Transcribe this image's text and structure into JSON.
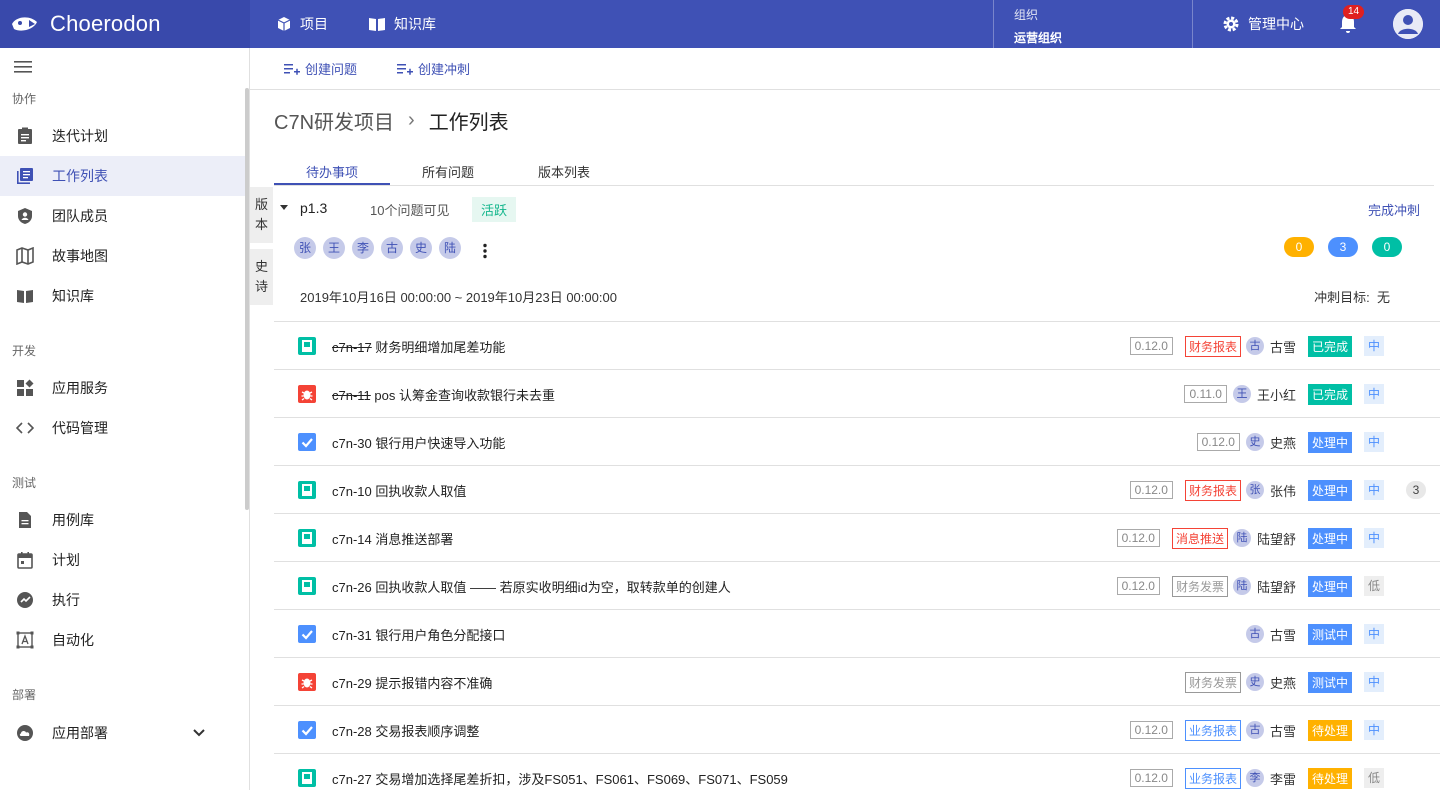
{
  "brand": {
    "name": "Choerodon"
  },
  "topnav": [
    {
      "label": "项目",
      "icon": "cube-icon"
    },
    {
      "label": "知识库",
      "icon": "book-icon"
    }
  ],
  "org": {
    "label": "组织",
    "value": "运营组织"
  },
  "admin": {
    "label": "管理中心"
  },
  "notifications": {
    "count": "14"
  },
  "sidebar": {
    "groups": [
      {
        "label": "协作",
        "items": [
          {
            "label": "迭代计划",
            "icon": "clipboard-icon"
          },
          {
            "label": "工作列表",
            "icon": "library-icon",
            "active": true
          },
          {
            "label": "团队成员",
            "icon": "shield-user-icon"
          },
          {
            "label": "故事地图",
            "icon": "map-icon"
          },
          {
            "label": "知识库",
            "icon": "book-icon"
          }
        ]
      },
      {
        "label": "开发",
        "items": [
          {
            "label": "应用服务",
            "icon": "widgets-icon"
          },
          {
            "label": "代码管理",
            "icon": "code-icon"
          }
        ]
      },
      {
        "label": "测试",
        "items": [
          {
            "label": "用例库",
            "icon": "document-icon"
          },
          {
            "label": "计划",
            "icon": "calendar-icon"
          },
          {
            "label": "执行",
            "icon": "speed-icon"
          },
          {
            "label": "自动化",
            "icon": "automation-icon"
          }
        ]
      },
      {
        "label": "部署",
        "items": [
          {
            "label": "应用部署",
            "icon": "cloud-icon"
          }
        ]
      }
    ]
  },
  "toolbar": {
    "create_issue": "创建问题",
    "create_sprint": "创建冲刺"
  },
  "breadcrumb": {
    "project": "C7N研发项目",
    "sep": "›",
    "page": "工作列表"
  },
  "tabs": [
    "待办事项",
    "所有问题",
    "版本列表"
  ],
  "side_tabs": {
    "version": "版本",
    "epic": "史诗"
  },
  "sprint": {
    "name": "p1.3",
    "count_text": "10个问题可见",
    "status": "活跃",
    "complete": "完成冲刺",
    "members": [
      "张",
      "王",
      "李",
      "古",
      "史",
      "陆"
    ],
    "counts": [
      {
        "value": "0",
        "color": "#ffb100"
      },
      {
        "value": "3",
        "color": "#4d90fe"
      },
      {
        "value": "0",
        "color": "#00bfa5"
      }
    ],
    "dates": "2019年10月16日 00:00:00 ~ 2019年10月23日 00:00:00",
    "goal_label": "冲刺目标:",
    "goal_value": "无"
  },
  "colors": {
    "primary": "#3f51b5",
    "story": "#00bfa5",
    "bug": "#f44336",
    "task": "#4d90fe",
    "done": "#00bfa5",
    "doing": "#4d90fe",
    "todo": "#ffb100"
  },
  "issues": [
    {
      "type": "story",
      "key": "c7n-17",
      "done": true,
      "summary": "财务明细增加尾差功能",
      "version": "0.12.0",
      "component": "财务报表",
      "comp_style": "red",
      "assignee_initial": "古",
      "assignee": "古雪",
      "status": "已完成",
      "status_kind": "done",
      "priority": "中",
      "prio_kind": "mid"
    },
    {
      "type": "bug",
      "key": "c7n-11",
      "done": true,
      "summary": "pos 认筹金查询收款银行未去重",
      "version": "0.11.0",
      "component": "",
      "comp_style": "",
      "assignee_initial": "王",
      "assignee": "王小红",
      "status": "已完成",
      "status_kind": "done",
      "priority": "中",
      "prio_kind": "mid"
    },
    {
      "type": "task",
      "key": "c7n-30",
      "done": false,
      "summary": "银行用户快速导入功能",
      "version": "0.12.0",
      "component": "",
      "comp_style": "",
      "assignee_initial": "史",
      "assignee": "史燕",
      "status": "处理中",
      "status_kind": "doing",
      "priority": "中",
      "prio_kind": "mid"
    },
    {
      "type": "story",
      "key": "c7n-10",
      "done": false,
      "summary": "回执收款人取值",
      "version": "0.12.0",
      "component": "财务报表",
      "comp_style": "red",
      "assignee_initial": "张",
      "assignee": "张伟",
      "status": "处理中",
      "status_kind": "doing",
      "priority": "中",
      "prio_kind": "mid",
      "story_points": "3"
    },
    {
      "type": "story",
      "key": "c7n-14",
      "done": false,
      "summary": "消息推送部署",
      "version": "0.12.0",
      "component": "消息推送",
      "comp_style": "red",
      "assignee_initial": "陆",
      "assignee": "陆望舒",
      "status": "处理中",
      "status_kind": "doing",
      "priority": "中",
      "prio_kind": "mid"
    },
    {
      "type": "story",
      "key": "c7n-26",
      "done": false,
      "summary": "回执收款人取值 —— 若原实收明细id为空，取转款单的创建人",
      "version": "0.12.0",
      "component": "财务发票",
      "comp_style": "gray",
      "assignee_initial": "陆",
      "assignee": "陆望舒",
      "status": "处理中",
      "status_kind": "doing",
      "priority": "低",
      "prio_kind": "low"
    },
    {
      "type": "task",
      "key": "c7n-31",
      "done": false,
      "summary": "银行用户角色分配接口",
      "version": "",
      "component": "",
      "comp_style": "",
      "assignee_initial": "古",
      "assignee": "古雪",
      "status": "测试中",
      "status_kind": "doing",
      "priority": "中",
      "prio_kind": "mid"
    },
    {
      "type": "bug",
      "key": "c7n-29",
      "done": false,
      "summary": "提示报错内容不准确",
      "version": "",
      "component": "财务发票",
      "comp_style": "gray",
      "assignee_initial": "史",
      "assignee": "史燕",
      "status": "测试中",
      "status_kind": "doing",
      "priority": "中",
      "prio_kind": "mid"
    },
    {
      "type": "task",
      "key": "c7n-28",
      "done": false,
      "summary": "交易报表顺序调整",
      "version": "0.12.0",
      "component": "业务报表",
      "comp_style": "blue",
      "assignee_initial": "古",
      "assignee": "古雪",
      "status": "待处理",
      "status_kind": "todo",
      "priority": "中",
      "prio_kind": "mid"
    },
    {
      "type": "story",
      "key": "c7n-27",
      "done": false,
      "summary": "交易增加选择尾差折扣，涉及FS051、FS061、FS069、FS071、FS059",
      "version": "0.12.0",
      "component": "业务报表",
      "comp_style": "blue",
      "assignee_initial": "李",
      "assignee": "李雷",
      "status": "待处理",
      "status_kind": "todo",
      "priority": "低",
      "prio_kind": "low"
    }
  ]
}
